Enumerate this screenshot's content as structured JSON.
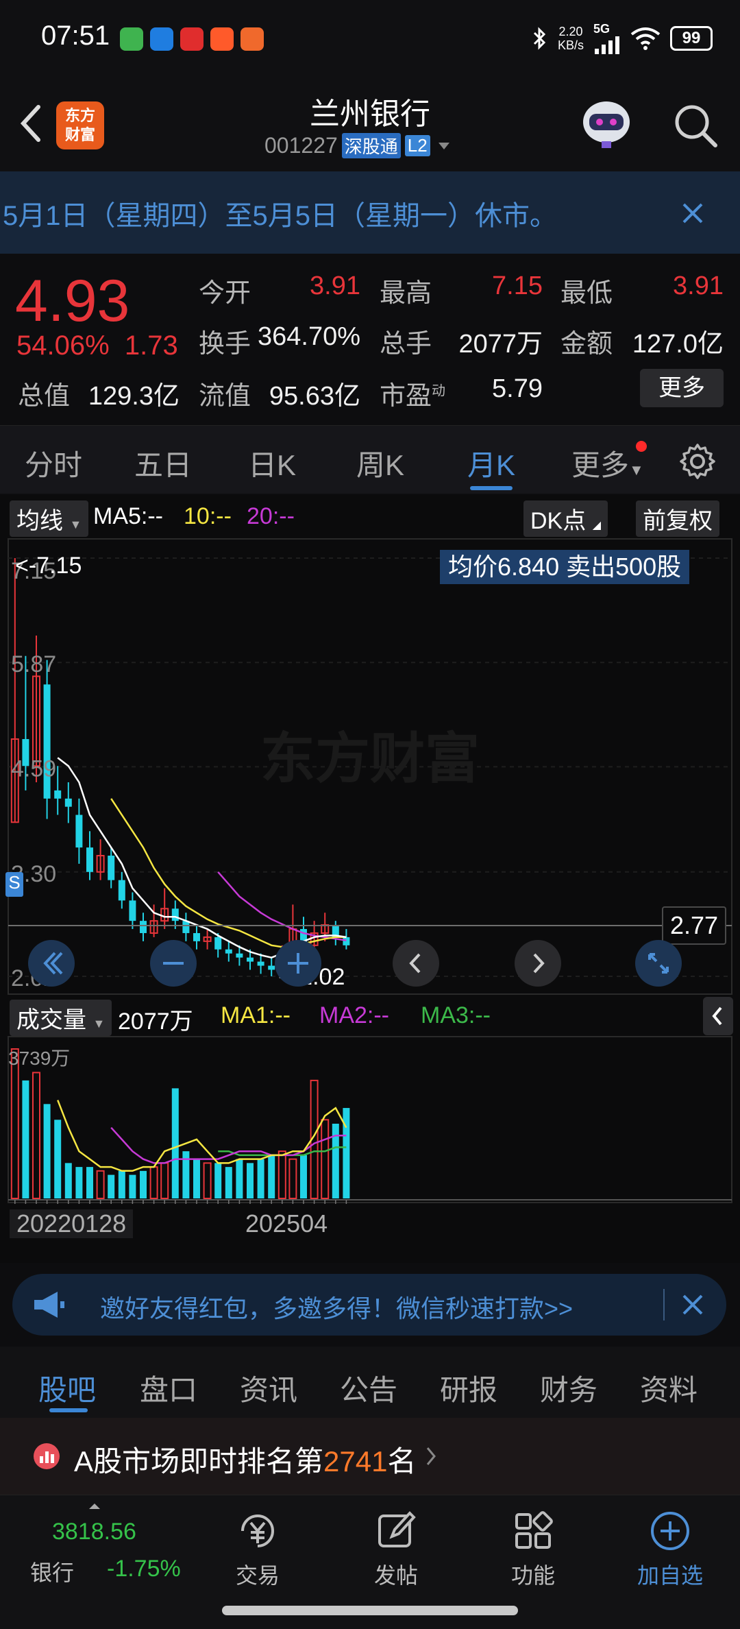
{
  "status_bar": {
    "time": "07:51",
    "net_speed_value": "2.20",
    "net_speed_unit": "KB/s",
    "network": "5G",
    "battery": "99"
  },
  "header": {
    "logo_line1": "东方",
    "logo_line2": "财富",
    "title": "兰州银行",
    "code": "001227",
    "tag_connect": "深股通",
    "tag_level": "L2"
  },
  "notice": {
    "text": "5月1日（星期四）至5月5日（星期一）休市。"
  },
  "quote": {
    "price": "4.93",
    "change_pct": "54.06%",
    "change": "1.73",
    "row1": [
      {
        "label": "今开",
        "value": "3.91"
      },
      {
        "label": "最高",
        "value": "7.15"
      },
      {
        "label": "最低",
        "value": "3.91"
      }
    ],
    "row2": [
      {
        "label": "换手",
        "value": "364.70%"
      },
      {
        "label": "总手",
        "value": "2077万"
      },
      {
        "label": "金额",
        "value": "127.0亿"
      }
    ],
    "row3": [
      {
        "label": "总值",
        "value": "129.3亿"
      },
      {
        "label": "流值",
        "value": "95.63亿"
      },
      {
        "label": "市盈",
        "sup": "动",
        "value": "5.79"
      }
    ],
    "more_label": "更多"
  },
  "tabs": {
    "items": [
      "分时",
      "五日",
      "日K",
      "周K",
      "月K",
      "更多"
    ],
    "active": "月K"
  },
  "chart": {
    "indicator_pill": "均线",
    "ma5": "MA5:--",
    "ma10": "10:--",
    "ma20": "20:--",
    "dk_pill": "DK点",
    "adjust_pill": "前复权",
    "y_labels": [
      "7.15",
      "5.87",
      "4.59",
      "3.30",
      "2.02"
    ],
    "max_marker": "<-7.15",
    "min_marker": "<-2.02",
    "avg_box": "均价6.840  卖出500股",
    "current_line": "2.77",
    "watermark": "东方财富",
    "vol_pill": "成交量",
    "vol_value": "2077万",
    "vol_ma1": "MA1:--",
    "vol_ma2": "MA2:--",
    "vol_ma3": "MA3:--",
    "vol_max": "3739万",
    "date_start": "20220128",
    "date_end": "202504",
    "colors": {
      "up": "#e8353a",
      "down": "#22d3e6",
      "ma5": "#ffffff",
      "ma10": "#f5e642",
      "ma20": "#c73ad6",
      "vma3": "#3cb94a"
    }
  },
  "chart_data": {
    "type": "candlestick",
    "title": "兰州银行 月K",
    "ylim": [
      2.02,
      7.15
    ],
    "candles": [
      {
        "o": 3.91,
        "c": 4.93,
        "h": 7.15,
        "l": 3.91
      },
      {
        "o": 4.93,
        "c": 4.6,
        "h": 5.95,
        "l": 4.3
      },
      {
        "o": 4.6,
        "c": 5.7,
        "h": 6.2,
        "l": 4.4
      },
      {
        "o": 5.6,
        "c": 4.2,
        "h": 5.9,
        "l": 3.95
      },
      {
        "o": 4.3,
        "c": 4.2,
        "h": 4.6,
        "l": 4.0
      },
      {
        "o": 4.2,
        "c": 4.1,
        "h": 4.4,
        "l": 3.9
      },
      {
        "o": 4.0,
        "c": 3.6,
        "h": 4.2,
        "l": 3.4
      },
      {
        "o": 3.6,
        "c": 3.3,
        "h": 3.8,
        "l": 3.2
      },
      {
        "o": 3.3,
        "c": 3.5,
        "h": 3.7,
        "l": 3.2
      },
      {
        "o": 3.5,
        "c": 3.2,
        "h": 3.6,
        "l": 3.1
      },
      {
        "o": 3.2,
        "c": 2.95,
        "h": 3.3,
        "l": 2.85
      },
      {
        "o": 2.95,
        "c": 2.7,
        "h": 3.05,
        "l": 2.6
      },
      {
        "o": 2.7,
        "c": 2.55,
        "h": 2.8,
        "l": 2.45
      },
      {
        "o": 2.55,
        "c": 2.7,
        "h": 2.9,
        "l": 2.5
      },
      {
        "o": 2.7,
        "c": 2.85,
        "h": 3.1,
        "l": 2.6
      },
      {
        "o": 2.85,
        "c": 2.7,
        "h": 2.95,
        "l": 2.6
      },
      {
        "o": 2.7,
        "c": 2.55,
        "h": 2.8,
        "l": 2.45
      },
      {
        "o": 2.55,
        "c": 2.45,
        "h": 2.65,
        "l": 2.35
      },
      {
        "o": 2.45,
        "c": 2.5,
        "h": 2.6,
        "l": 2.35
      },
      {
        "o": 2.5,
        "c": 2.35,
        "h": 2.55,
        "l": 2.25
      },
      {
        "o": 2.35,
        "c": 2.3,
        "h": 2.45,
        "l": 2.2
      },
      {
        "o": 2.3,
        "c": 2.25,
        "h": 2.4,
        "l": 2.15
      },
      {
        "o": 2.25,
        "c": 2.2,
        "h": 2.35,
        "l": 2.1
      },
      {
        "o": 2.2,
        "c": 2.15,
        "h": 2.3,
        "l": 2.05
      },
      {
        "o": 2.15,
        "c": 2.1,
        "h": 2.25,
        "l": 2.02
      },
      {
        "o": 2.1,
        "c": 2.3,
        "h": 2.4,
        "l": 2.05
      },
      {
        "o": 2.3,
        "c": 2.6,
        "h": 2.9,
        "l": 2.25
      },
      {
        "o": 2.6,
        "c": 2.4,
        "h": 2.75,
        "l": 2.3
      },
      {
        "o": 2.4,
        "c": 2.55,
        "h": 2.7,
        "l": 2.35
      },
      {
        "o": 2.55,
        "c": 2.65,
        "h": 2.8,
        "l": 2.45
      },
      {
        "o": 2.65,
        "c": 2.5,
        "h": 2.7,
        "l": 2.4
      },
      {
        "o": 2.5,
        "c": 2.4,
        "h": 2.6,
        "l": 2.35
      }
    ],
    "ma5": [
      null,
      null,
      null,
      null,
      4.7,
      4.6,
      4.4,
      4.0,
      3.8,
      3.6,
      3.4,
      3.1,
      2.95,
      2.8,
      2.75,
      2.75,
      2.7,
      2.65,
      2.6,
      2.52,
      2.45,
      2.38,
      2.32,
      2.28,
      2.25,
      2.3,
      2.38,
      2.45,
      2.5,
      2.52,
      2.52,
      2.5
    ],
    "ma10": [
      null,
      null,
      null,
      null,
      null,
      null,
      null,
      null,
      null,
      4.2,
      4.0,
      3.8,
      3.6,
      3.35,
      3.15,
      3.0,
      2.88,
      2.8,
      2.72,
      2.66,
      2.62,
      2.58,
      2.52,
      2.46,
      2.4,
      2.38,
      2.4,
      2.42,
      2.45,
      2.48,
      2.5,
      2.5
    ],
    "ma20": [
      null,
      null,
      null,
      null,
      null,
      null,
      null,
      null,
      null,
      null,
      null,
      null,
      null,
      null,
      null,
      null,
      null,
      null,
      null,
      3.3,
      3.15,
      3.0,
      2.9,
      2.8,
      2.72,
      2.66,
      2.6,
      2.55,
      2.52,
      2.5,
      2.48,
      2.46
    ],
    "volume": [
      38,
      30,
      32,
      24,
      20,
      9,
      8,
      8,
      7,
      6,
      7,
      6,
      7,
      8,
      9,
      28,
      12,
      10,
      9,
      9,
      8,
      10,
      9,
      10,
      11,
      12,
      10,
      11,
      30,
      20,
      19,
      23
    ],
    "vma1": [
      null,
      null,
      null,
      null,
      25,
      18,
      12,
      10,
      8,
      8,
      7,
      7,
      8,
      8,
      12,
      13,
      14,
      15,
      12,
      9,
      9,
      10,
      10,
      10,
      11,
      11,
      12,
      12,
      16,
      21,
      23,
      18
    ],
    "vma2": [
      null,
      null,
      null,
      null,
      null,
      null,
      null,
      null,
      null,
      18,
      15,
      12,
      10,
      9,
      9,
      10,
      10,
      10,
      10,
      10,
      11,
      12,
      12,
      12,
      11,
      11,
      11,
      12,
      14,
      15,
      16,
      16
    ],
    "vma3": [
      null,
      null,
      null,
      null,
      null,
      null,
      null,
      null,
      null,
      null,
      null,
      null,
      null,
      null,
      null,
      null,
      null,
      null,
      null,
      12,
      12,
      11,
      11,
      11,
      11,
      11,
      11,
      11,
      12,
      12,
      13,
      13
    ],
    "vol_unit": "万",
    "vol_max": 3739
  },
  "invite": {
    "text": "邀好友得红包，多邀多得！微信秒速打款>>"
  },
  "sub_tabs": {
    "items": [
      "股吧",
      "盘口",
      "资讯",
      "公告",
      "研报",
      "财务",
      "资料"
    ],
    "active": "股吧"
  },
  "rank": {
    "prefix": "A股市场即时排名第",
    "number": "2741",
    "suffix": "名"
  },
  "bottom_nav": {
    "index_value": "3818.56",
    "index_name": "银行",
    "index_change": "-1.75%",
    "items": [
      {
        "label": "交易",
        "icon": "yen-icon"
      },
      {
        "label": "发帖",
        "icon": "edit-icon"
      },
      {
        "label": "功能",
        "icon": "grid-icon"
      },
      {
        "label": "加自选",
        "icon": "plus-circle-icon"
      }
    ]
  }
}
